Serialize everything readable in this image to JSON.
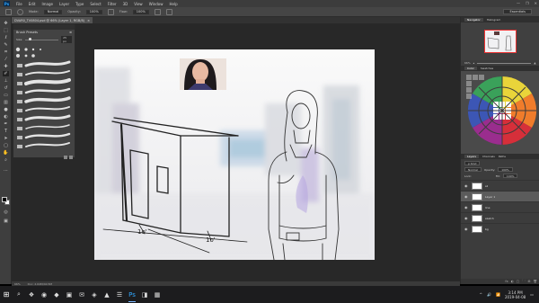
{
  "window": {
    "app_icon": "Ps",
    "menu": [
      "File",
      "Edit",
      "Image",
      "Layer",
      "Type",
      "Select",
      "Filter",
      "3D",
      "View",
      "Window",
      "Help"
    ],
    "controls": [
      "—",
      "❐",
      "✕"
    ]
  },
  "options_bar": {
    "mode_label": "Mode:",
    "mode_value": "Normal",
    "opacity_label": "Opacity:",
    "opacity_value": "100%",
    "flow_label": "Flow:",
    "flow_value": "100%",
    "workspace": "Essentials"
  },
  "document_tab": {
    "title": "DVAR0_TV0804.psd @ 66% (Layer 1, RGB/8)",
    "close": "×"
  },
  "brush_panel": {
    "title": "Brush Presets",
    "size_label": "Size:",
    "size_value": "25 px",
    "menu_icon": "≡"
  },
  "navigator": {
    "tabs": [
      "Navigator",
      "Histogram"
    ],
    "zoom": "66%"
  },
  "swatches": {
    "tabs": [
      "Color",
      "Swatches"
    ]
  },
  "layers": {
    "tabs": [
      "Layers",
      "Channels",
      "Paths"
    ],
    "kind_label": "ρ Kind",
    "blend_mode": "Normal",
    "opacity_label": "Opacity:",
    "opacity_value": "100%",
    "lock_label": "Lock:",
    "fill_label": "Fill:",
    "fill_value": "100%",
    "items": [
      {
        "name": "sil",
        "selected": false
      },
      {
        "name": "Layer 1",
        "selected": true
      },
      {
        "name": "line",
        "selected": false
      },
      {
        "name": "sketch",
        "selected": false
      },
      {
        "name": "bg",
        "selected": false
      }
    ],
    "footer_icons": [
      "fx",
      "◐",
      "▢",
      "🗀",
      "⊞",
      "🗑"
    ]
  },
  "status": {
    "zoom": "66%",
    "doc": "Doc: 2.64M/40.5M"
  },
  "taskbar": {
    "apps": [
      "⌕",
      "❖",
      "◉",
      "◆",
      "▣",
      "✉",
      "◈",
      "▲",
      "☰",
      "Ps",
      "◨",
      "▦"
    ],
    "tray_icons": [
      "^",
      "🔊",
      "📶"
    ],
    "time": "3:14 PM",
    "date": "2019-04-08"
  },
  "colors": {
    "accent": "#31a8ff",
    "panel": "#3c3c3c",
    "workspace": "#282828"
  }
}
